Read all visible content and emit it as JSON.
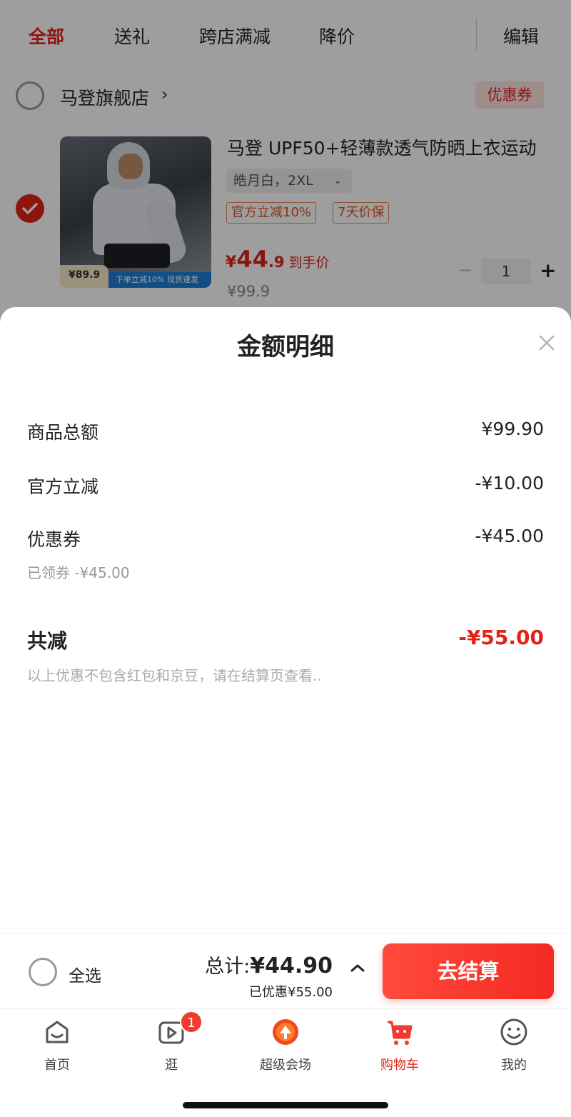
{
  "filter_tabs": [
    "全部",
    "送礼",
    "跨店满减",
    "降价"
  ],
  "edit_label": "编辑",
  "store": {
    "name": "马登旗舰店",
    "chevron": "›",
    "coupon_tag": "优惠券"
  },
  "product": {
    "title": "马登 UPF50+轻薄款透气防晒上衣运动",
    "variant": "皓月白，2XL",
    "variant_chevron": "⌄",
    "promo_tags": [
      "官方立减10%",
      "7天价保"
    ],
    "price_currency": "¥",
    "price_int": "44",
    "price_dec": ".9",
    "price_label": "到手价",
    "original_price": "¥99.9",
    "quantity": "1",
    "qty_minus": "−",
    "qty_plus": "+",
    "image_badge_price": "¥89.9",
    "image_banner_text": "下单立减10%  现货速发"
  },
  "sheet": {
    "title": "金额明细",
    "rows": [
      {
        "label": "商品总额",
        "value": "¥99.90"
      },
      {
        "label": "官方立减",
        "value": "-¥10.00"
      },
      {
        "label": "优惠券",
        "value": "-¥45.00"
      }
    ],
    "coupon_sub": "已领券 -¥45.00",
    "total_label": "共减",
    "total_value": "-¥55.00",
    "note": "以上优惠不包含红包和京豆，请在结算页查看.."
  },
  "checkout": {
    "select_all": "全选",
    "total_label": "总计:",
    "total_value": "¥44.90",
    "saved": "已优惠¥55.00",
    "button": "去结算"
  },
  "nav": [
    {
      "label": "首页",
      "icon": "home-icon"
    },
    {
      "label": "逛",
      "icon": "video-icon",
      "badge": "1"
    },
    {
      "label": "超级会场",
      "icon": "super-venue-icon"
    },
    {
      "label": "购物车",
      "icon": "cart-icon",
      "active": true
    },
    {
      "label": "我的",
      "icon": "profile-icon"
    }
  ],
  "colors": {
    "accent": "#e2231a",
    "button": "#f42a22",
    "muted": "#999999"
  }
}
